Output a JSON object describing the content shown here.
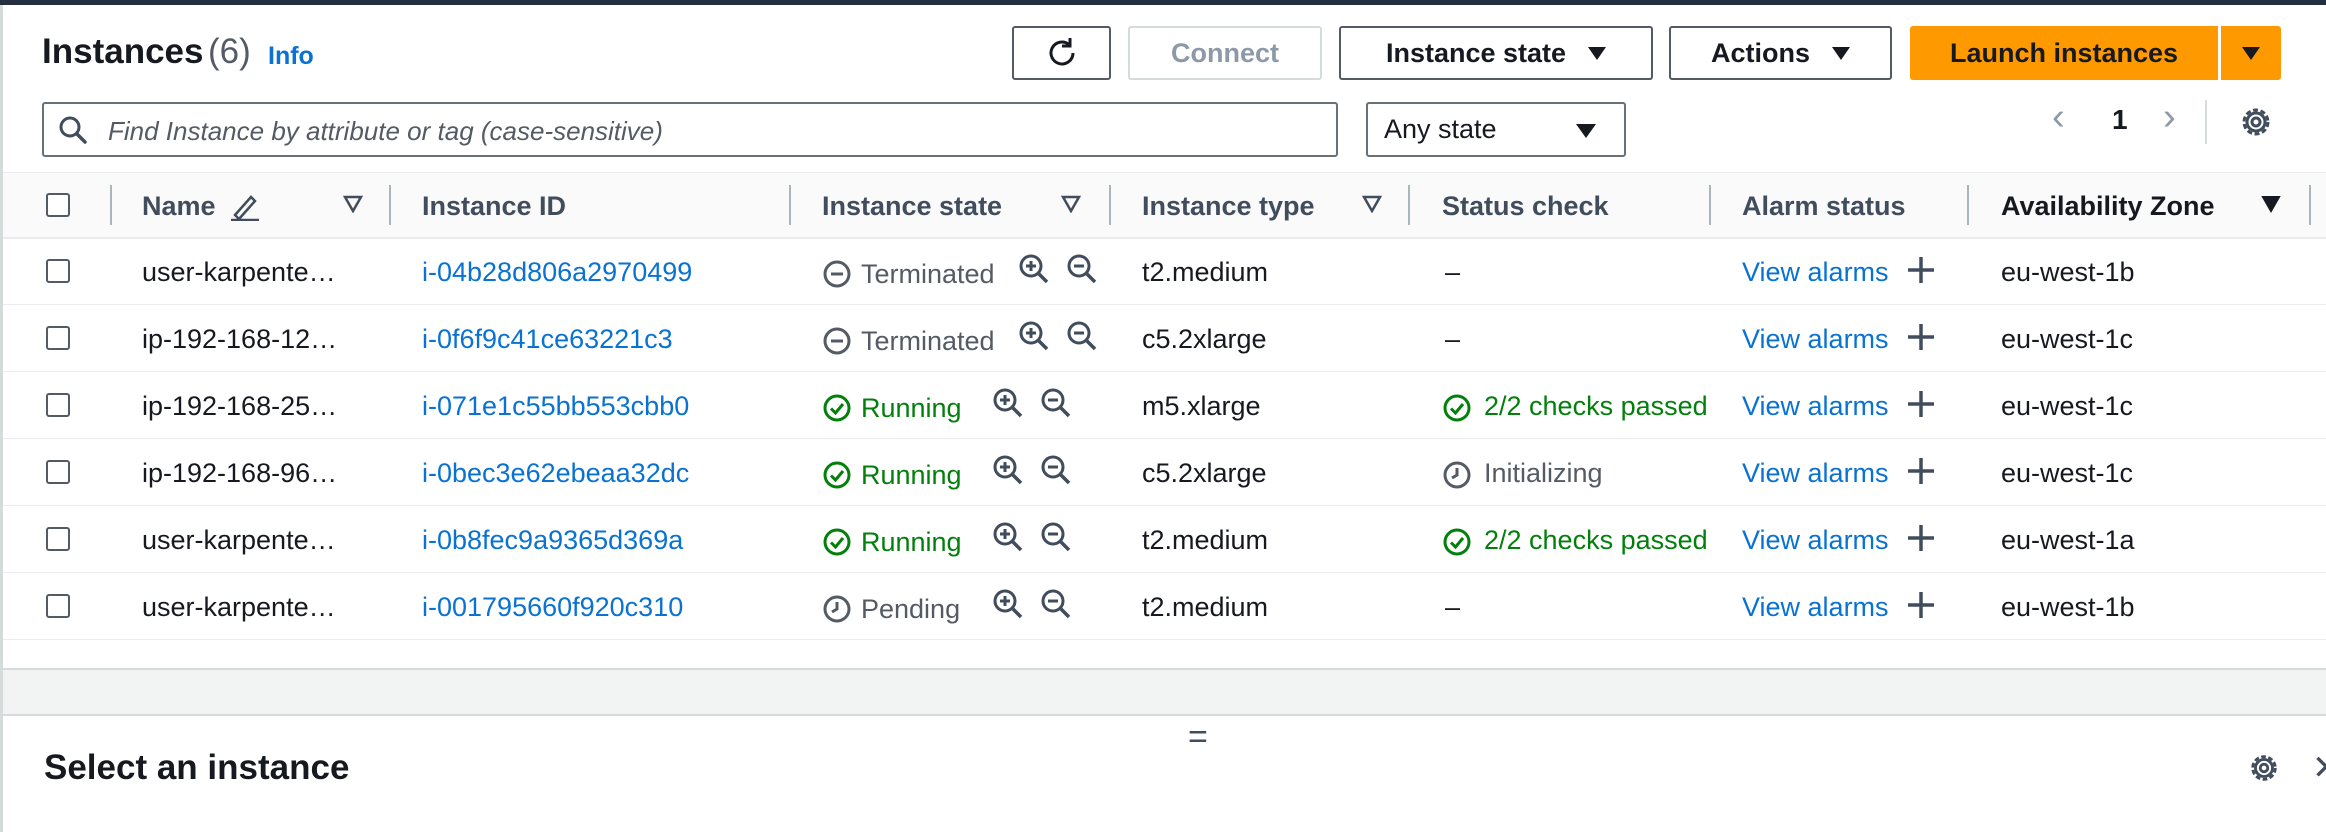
{
  "header": {
    "title": "Instances",
    "count": "(6)",
    "info": "Info"
  },
  "toolbar": {
    "connect": "Connect",
    "instance_state": "Instance state",
    "actions": "Actions",
    "launch": "Launch instances"
  },
  "search": {
    "placeholder": "Find Instance by attribute or tag (case-sensitive)",
    "state_filter": "Any state"
  },
  "pagination": {
    "page": "1"
  },
  "columns": {
    "name": "Name",
    "instance_id": "Instance ID",
    "instance_state": "Instance state",
    "instance_type": "Instance type",
    "status_check": "Status check",
    "alarm_status": "Alarm status",
    "availability_zone": "Availability Zone"
  },
  "rows": [
    {
      "name": "user-karpente…",
      "id": "i-04b28d806a2970499",
      "state": "Terminated",
      "type": "t2.medium",
      "status": "–",
      "alarm": "View alarms",
      "az": "eu-west-1b"
    },
    {
      "name": "ip-192-168-12…",
      "id": "i-0f6f9c41ce63221c3",
      "state": "Terminated",
      "type": "c5.2xlarge",
      "status": "–",
      "alarm": "View alarms",
      "az": "eu-west-1c"
    },
    {
      "name": "ip-192-168-25…",
      "id": "i-071e1c55bb553cbb0",
      "state": "Running",
      "type": "m5.xlarge",
      "status": "2/2 checks passed",
      "alarm": "View alarms",
      "az": "eu-west-1c"
    },
    {
      "name": "ip-192-168-96…",
      "id": "i-0bec3e62ebeaa32dc",
      "state": "Running",
      "type": "c5.2xlarge",
      "status": "Initializing",
      "alarm": "View alarms",
      "az": "eu-west-1c"
    },
    {
      "name": "user-karpente…",
      "id": "i-0b8fec9a9365d369a",
      "state": "Running",
      "type": "t2.medium",
      "status": "2/2 checks passed",
      "alarm": "View alarms",
      "az": "eu-west-1a"
    },
    {
      "name": "user-karpente…",
      "id": "i-001795660f920c310",
      "state": "Pending",
      "type": "t2.medium",
      "status": "–",
      "alarm": "View alarms",
      "az": "eu-west-1b"
    }
  ],
  "details": {
    "drag_handle": "=",
    "title": "Select an instance"
  },
  "colors": {
    "accent": "#0972d3",
    "launch": "#ff9900",
    "running": "#037f0c",
    "neutral": "#545b64"
  }
}
